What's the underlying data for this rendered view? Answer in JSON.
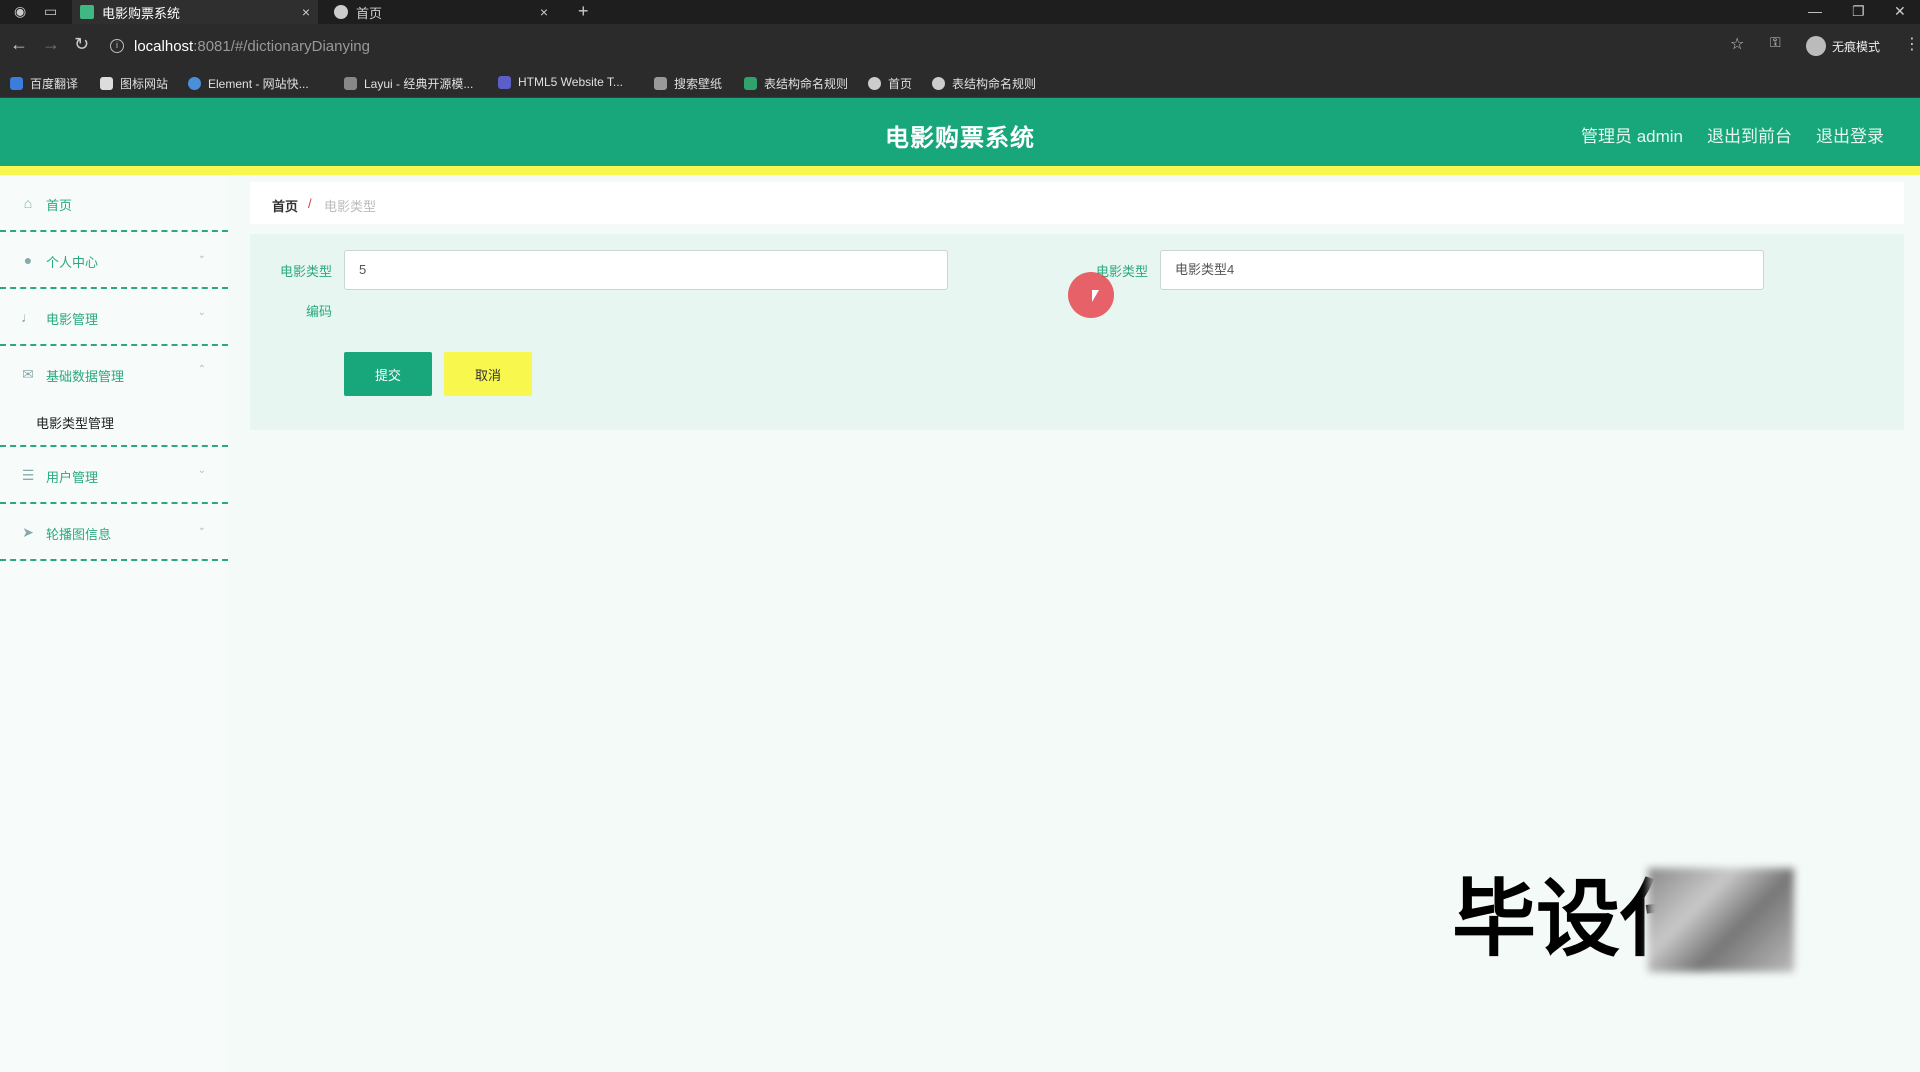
{
  "browser": {
    "tabs": [
      {
        "label": "电影购票系统",
        "active": true
      },
      {
        "label": "首页",
        "active": false
      }
    ],
    "new_tab": "+",
    "url_host": "localhost",
    "url_path": ":8081/#/dictionaryDianying",
    "incognito_label": "无痕模式",
    "bookmarks": [
      "百度翻译",
      "图标网站",
      "Element - 网站快...",
      "Layui - 经典开源模...",
      "HTML5 Website T...",
      "搜索壁纸",
      "表结构命名规则",
      "首页",
      "表结构命名规则"
    ]
  },
  "header": {
    "title": "电影购票系统",
    "admin_label": "管理员 admin",
    "back_label": "退出到前台",
    "logout_label": "退出登录",
    "colors": {
      "primary": "#18a77a",
      "accent": "#f7f74d"
    }
  },
  "sidebar": {
    "items": [
      {
        "label": "首页",
        "icon": "home-icon"
      },
      {
        "label": "个人中心",
        "icon": "user-icon"
      },
      {
        "label": "电影管理",
        "icon": "microphone-icon"
      },
      {
        "label": "基础数据管理",
        "icon": "mail-icon"
      },
      {
        "label": "用户管理",
        "icon": "list-icon"
      },
      {
        "label": "轮播图信息",
        "icon": "send-icon"
      }
    ],
    "submenu": {
      "label": "电影类型管理"
    }
  },
  "breadcrumb": {
    "home": "首页",
    "separator": "/",
    "current": "电影类型"
  },
  "form": {
    "type_label": "电影类型",
    "type_value": "5",
    "name_label": "电影类型",
    "name_value": "电影类型4",
    "code_label": "编码",
    "submit": "提交",
    "cancel": "取消"
  },
  "watermark": {
    "text": "毕设代"
  }
}
